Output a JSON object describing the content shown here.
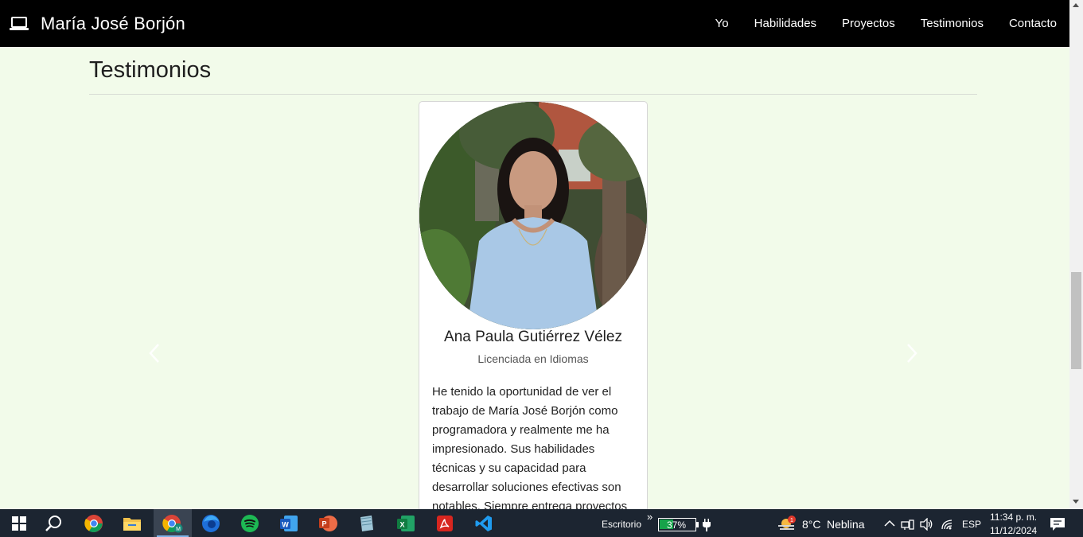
{
  "navbar": {
    "brand_icon": "laptop-icon",
    "brand": "María José Borjón",
    "links": [
      "Yo",
      "Habilidades",
      "Proyectos",
      "Testimonios",
      "Contacto"
    ]
  },
  "section": {
    "title": "Testimonios"
  },
  "testimonial": {
    "name": "Ana Paula Gutiérrez Vélez",
    "role": "Licenciada en Idiomas",
    "text": "He tenido la oportunidad de ver el trabajo de María José Borjón como programadora y realmente me ha impresionado. Sus habilidades técnicas y su capacidad para desarrollar soluciones efectivas son notables. Siempre entrega proyectos bien"
  },
  "taskbar": {
    "desktop_label": "Escritorio",
    "overflow": "»",
    "battery": "37%",
    "weather_temp": "8°C",
    "weather_desc": "Neblina",
    "language": "ESP",
    "time": "11:34 p. m.",
    "date": "11/12/2024",
    "apps": [
      "start-icon",
      "search-icon",
      "chrome-icon",
      "file-explorer-icon",
      "chrome-profile-icon",
      "firefox-icon",
      "spotify-icon",
      "word-icon",
      "powerpoint-icon",
      "notepad-icon",
      "excel-icon",
      "acrobat-icon",
      "vscode-icon"
    ]
  },
  "colors": {
    "page_bg": "#f2fbea",
    "navbar_bg": "#000000",
    "taskbar_bg": "#1c2531"
  }
}
